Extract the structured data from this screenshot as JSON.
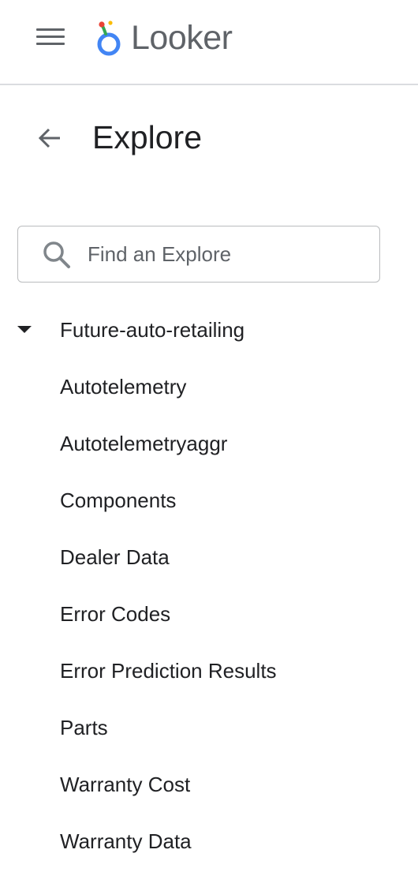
{
  "header": {
    "menu_icon": "hamburger-menu-icon",
    "logo_text": "Looker",
    "logo_colors": {
      "ring": "#4285F4",
      "stem": "#34A853",
      "dot_red": "#EA4335",
      "dot_yellow": "#FBBC04"
    }
  },
  "page": {
    "back_icon": "arrow-back-icon",
    "title": "Explore"
  },
  "search": {
    "icon": "search-icon",
    "placeholder": "Find an Explore",
    "value": ""
  },
  "tree": {
    "group": {
      "label": "Future-auto-retailing",
      "expanded": true,
      "caret_icon": "caret-down-icon"
    },
    "items": [
      {
        "label": "Autotelemetry"
      },
      {
        "label": "Autotelemetryaggr"
      },
      {
        "label": "Components"
      },
      {
        "label": "Dealer Data"
      },
      {
        "label": "Error Codes"
      },
      {
        "label": "Error Prediction Results"
      },
      {
        "label": "Parts"
      },
      {
        "label": "Warranty Cost"
      },
      {
        "label": "Warranty Data"
      }
    ]
  }
}
